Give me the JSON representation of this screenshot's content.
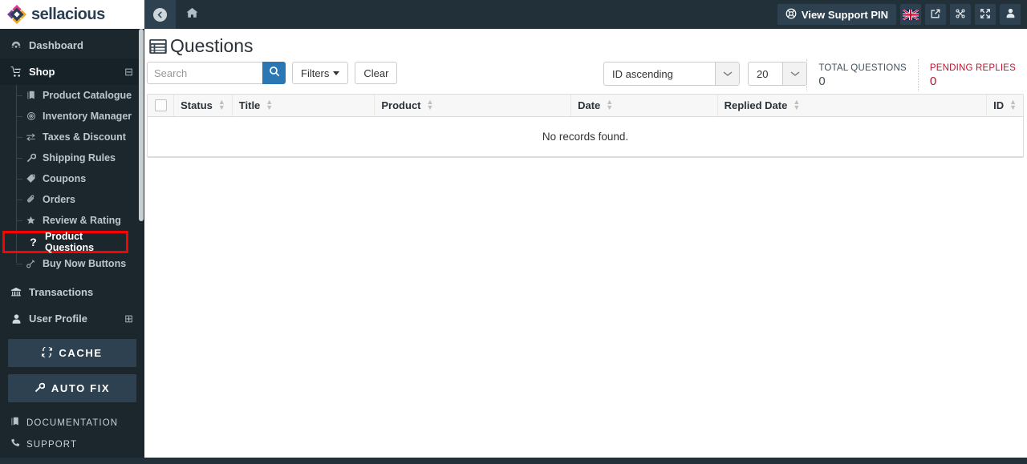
{
  "brand": {
    "name": "sellacious",
    "logo_icon": "diamond-logo-icon",
    "accent_blue": "#2b77b4",
    "sidebar_bg": "#1c262d",
    "topbar_bg": "#22303a",
    "highlight_color": "#ff0000"
  },
  "sidebar": {
    "items": [
      {
        "label": "Dashboard",
        "icon": "dashboard-icon",
        "glyph": "◕",
        "active": false,
        "toggle": ""
      },
      {
        "label": "Shop",
        "icon": "cart-icon",
        "glyph": "🛒",
        "active": true,
        "toggle": "⊟"
      }
    ],
    "submenu": [
      {
        "label": "Product Catalogue",
        "icon": "book-icon",
        "glyph": "▤"
      },
      {
        "label": "Inventory Manager",
        "icon": "target-icon",
        "glyph": "◎"
      },
      {
        "label": "Taxes & Discount",
        "icon": "exchange-icon",
        "glyph": "⇄"
      },
      {
        "label": "Shipping Rules",
        "icon": "wrench-icon",
        "glyph": "🔧"
      },
      {
        "label": "Coupons",
        "icon": "tag-icon",
        "glyph": "🏷"
      },
      {
        "label": "Orders",
        "icon": "paperclip-icon",
        "glyph": "📎"
      },
      {
        "label": "Review & Rating",
        "icon": "star-half-icon",
        "glyph": "★"
      },
      {
        "label": "Product Questions",
        "icon": "question-icon",
        "glyph": "?",
        "highlighted": true
      },
      {
        "label": "Buy Now Buttons",
        "icon": "link-icon",
        "glyph": "🔗"
      }
    ],
    "items_bottom": [
      {
        "label": "Transactions",
        "icon": "bank-icon",
        "glyph": "🏛",
        "toggle": ""
      },
      {
        "label": "User Profile",
        "icon": "user-icon",
        "glyph": "👤",
        "toggle": "⊞"
      }
    ],
    "buttons": [
      {
        "label": "CACHE",
        "icon": "refresh-icon",
        "glyph": "⟳"
      },
      {
        "label": "AUTO FIX",
        "icon": "wrench-icon",
        "glyph": "🔧"
      }
    ],
    "links": [
      {
        "label": "DOCUMENTATION",
        "icon": "book-icon",
        "glyph": "▤"
      },
      {
        "label": "SUPPORT",
        "icon": "phone-icon",
        "glyph": "✆"
      }
    ]
  },
  "topbar": {
    "back_icon": "back-arrow-icon",
    "home_icon": "home-icon",
    "support_pin_label": "View Support PIN",
    "support_pin_icon": "lifebuoy-icon",
    "icons": [
      {
        "name": "uk-flag-icon"
      },
      {
        "name": "external-link-icon",
        "glyph": "↗"
      },
      {
        "name": "joomla-logo-icon",
        "glyph": "✖"
      },
      {
        "name": "fullscreen-icon",
        "glyph": "⤢"
      },
      {
        "name": "user-avatar-icon",
        "glyph": "👤"
      }
    ]
  },
  "page": {
    "title": "Questions",
    "title_icon": "list-view-icon"
  },
  "toolbar": {
    "search_placeholder": "Search",
    "search_value": "",
    "search_icon": "search-icon",
    "filters_label": "Filters",
    "clear_label": "Clear",
    "sort_value": "ID ascending",
    "limit_value": "20",
    "stats": [
      {
        "label": "TOTAL QUESTIONS",
        "value": "0",
        "kind": "total"
      },
      {
        "label": "PENDING REPLIES",
        "value": "0",
        "kind": "pending"
      }
    ]
  },
  "table": {
    "columns": [
      {
        "label": "Status",
        "sortable": true
      },
      {
        "label": "Title",
        "sortable": true
      },
      {
        "label": "Product",
        "sortable": true
      },
      {
        "label": "Date",
        "sortable": true
      },
      {
        "label": "Replied Date",
        "sortable": true
      },
      {
        "label": "ID",
        "sortable": true
      }
    ],
    "rows": [],
    "empty_message": "No records found."
  }
}
